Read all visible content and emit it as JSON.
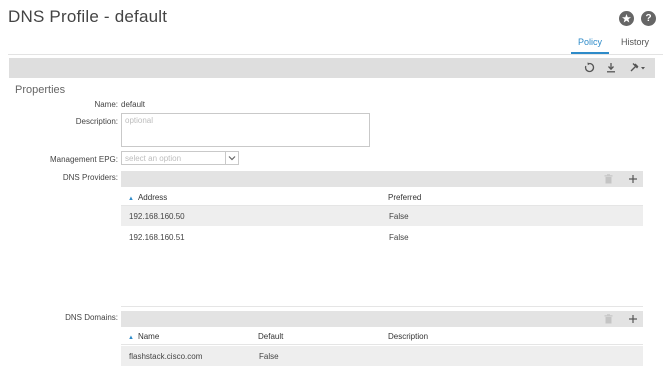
{
  "page": {
    "title": "DNS Profile - default"
  },
  "header_icons": {
    "star": "star-icon",
    "help": "question-icon",
    "help_glyph": "?"
  },
  "tabs": [
    {
      "label": "Policy",
      "active": true
    },
    {
      "label": "History",
      "active": false
    }
  ],
  "toolbar": {
    "icons": [
      "refresh-icon",
      "download-icon",
      "tools-icon"
    ]
  },
  "properties": {
    "section_title": "Properties",
    "name_label": "Name:",
    "name_value": "default",
    "description_label": "Description:",
    "description_placeholder": "optional",
    "mgmt_epg_label": "Management EPG:",
    "mgmt_epg_placeholder": "select an option"
  },
  "dns_providers": {
    "label": "DNS Providers:",
    "columns": [
      "Address",
      "Preferred"
    ],
    "rows": [
      {
        "address": "192.168.160.50",
        "preferred": "False"
      },
      {
        "address": "192.168.160.51",
        "preferred": "False"
      }
    ]
  },
  "dns_domains": {
    "label": "DNS Domains:",
    "columns": [
      "Name",
      "Default",
      "Description"
    ],
    "rows": [
      {
        "name": "flashstack.cisco.com",
        "default": "False",
        "description": ""
      }
    ]
  },
  "colors": {
    "accent": "#2e8bc9",
    "toolbar_bg": "#dedede",
    "row_shade": "#eeeeee"
  }
}
